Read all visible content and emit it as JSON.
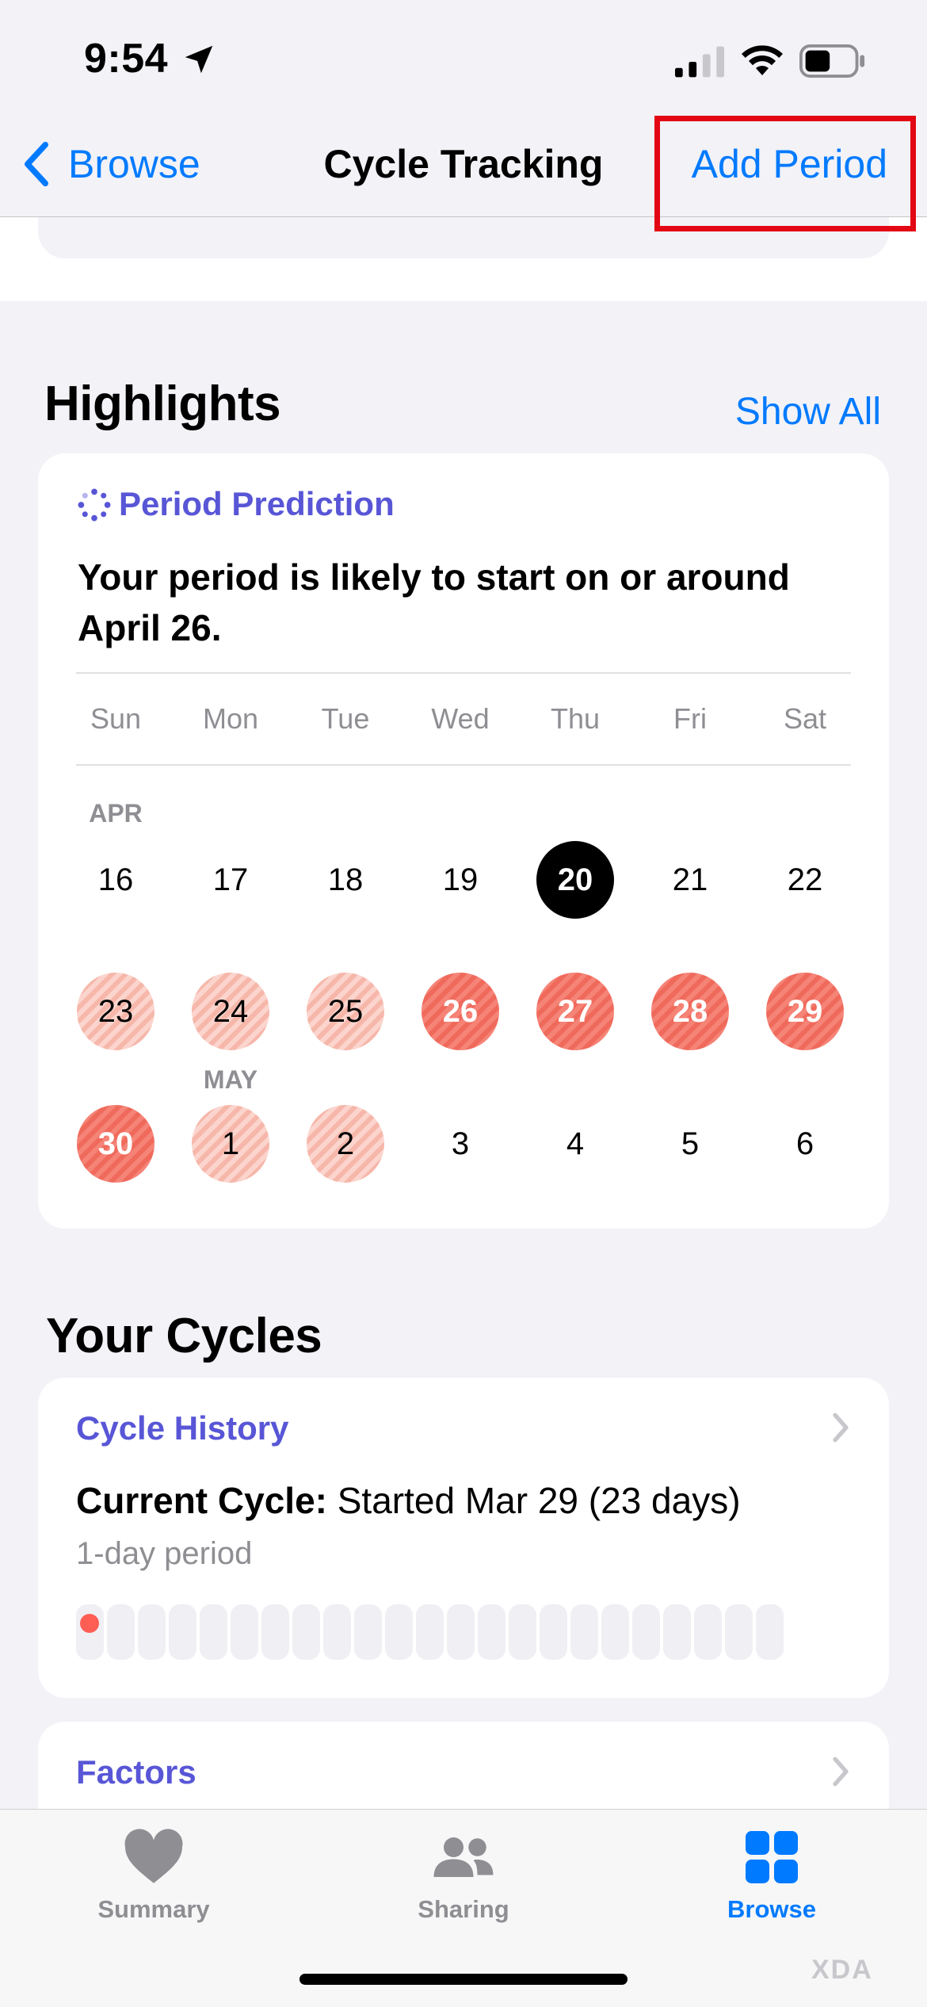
{
  "status": {
    "time": "9:54"
  },
  "nav": {
    "back_label": "Browse",
    "title": "Cycle Tracking",
    "action_label": "Add Period"
  },
  "highlights": {
    "title": "Highlights",
    "show_all": "Show All",
    "prediction": {
      "title": "Period Prediction",
      "text": "Your period is likely to start on or around April 26.",
      "weekdays": [
        "Sun",
        "Mon",
        "Tue",
        "Wed",
        "Thu",
        "Fri",
        "Sat"
      ],
      "month_apr": "APR",
      "month_may": "MAY",
      "week1": [
        "16",
        "17",
        "18",
        "19",
        "20",
        "21",
        "22"
      ],
      "week2": [
        "23",
        "24",
        "25",
        "26",
        "27",
        "28",
        "29"
      ],
      "week3": [
        "30",
        "1",
        "2",
        "3",
        "4",
        "5",
        "6"
      ]
    }
  },
  "cycles": {
    "title": "Your Cycles",
    "history_label": "Cycle History",
    "current_label": "Current Cycle:",
    "current_value": "Started Mar 29 (23 days)",
    "period_length": "1-day period",
    "factors_label": "Factors"
  },
  "tabs": {
    "summary": "Summary",
    "sharing": "Sharing",
    "browse": "Browse"
  },
  "watermark": "XDA",
  "colors": {
    "accent": "#007aff",
    "purple": "#5856d6",
    "period": "#f06a5c",
    "highlight_box": "#e30613"
  }
}
